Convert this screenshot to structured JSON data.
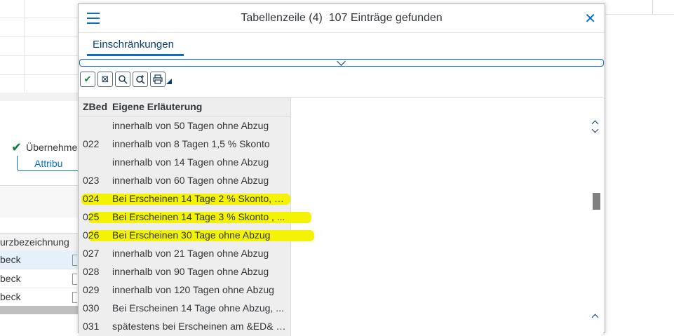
{
  "background": {
    "accept_button": "Übernehme",
    "attribute_button": "Attribu",
    "table_header": "urzbezeichnung",
    "rows": [
      "beck",
      "beck",
      "beck"
    ]
  },
  "dialog": {
    "title": "Tabellenzeile (4)  107 Einträge gefunden",
    "tab_label": "Einschränkungen",
    "columns": {
      "code": "ZBed",
      "description": "Eigene Erläuterung"
    },
    "rows": [
      {
        "code": "",
        "description": "innerhalb von 50 Tagen ohne Abzug",
        "highlighted": false
      },
      {
        "code": "022",
        "description": "innerhalb von 8 Tagen 1,5 % Skonto",
        "highlighted": false
      },
      {
        "code": "",
        "description": "innerhalb von 14 Tagen ohne Abzug",
        "highlighted": false
      },
      {
        "code": "023",
        "description": "innerhalb von 60 Tagen ohne Abzug",
        "highlighted": false
      },
      {
        "code": "024",
        "description": "Bei Erscheinen 14 Tage 2 % Skonto, 3...",
        "highlighted": true
      },
      {
        "code": "025",
        "description": "Bei Erscheinen 14 Tage 3 % Skonto , ...",
        "highlighted": true
      },
      {
        "code": "026",
        "description": "Bei Erscheinen 30 Tage ohne Abzug",
        "highlighted": true
      },
      {
        "code": "027",
        "description": "innerhalb von 21 Tagen ohne Abzug",
        "highlighted": false
      },
      {
        "code": "028",
        "description": "innerhalb von 90 Tagen ohne Abzug",
        "highlighted": false
      },
      {
        "code": "029",
        "description": "innerhalb von 120 Tagen ohne Abzug",
        "highlighted": false
      },
      {
        "code": "030",
        "description": "Bei Erscheinen 14 Tage ohne Abzug, ...",
        "highlighted": false
      },
      {
        "code": "031",
        "description": "spätestens bei Erscheinen am &ED& o...",
        "highlighted": false
      }
    ]
  },
  "colors": {
    "accent": "#0a6ed1",
    "highlight": "#f3f303",
    "ok_green": "#107e3e"
  },
  "icons": [
    "menu-icon",
    "close-icon",
    "chevron-down-icon",
    "check-icon",
    "cancel-icon",
    "search-icon",
    "search-plus-icon",
    "print-icon",
    "dropdown-arrow-icon"
  ]
}
